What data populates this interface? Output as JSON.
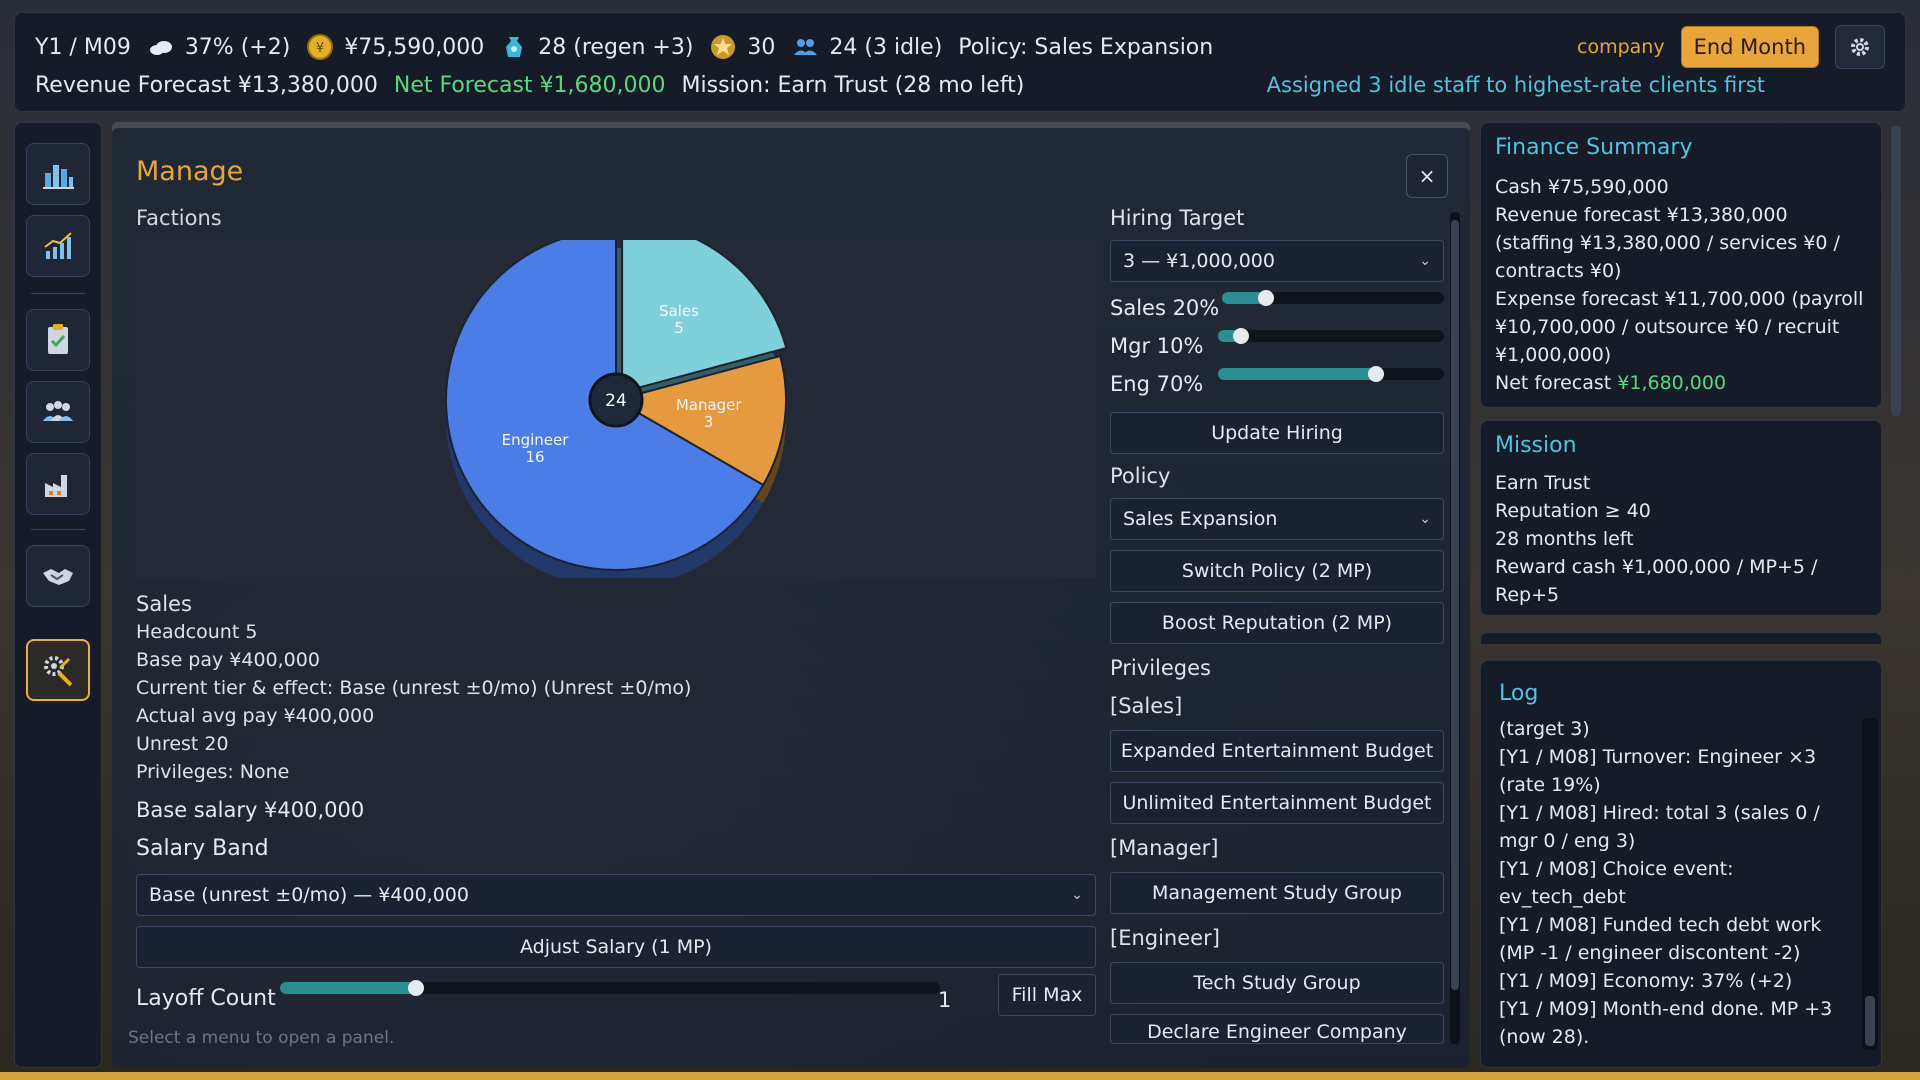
{
  "topbar": {
    "date": "Y1 / M09",
    "economy": "37% (+2)",
    "cash": "¥75,590,000",
    "mp": "28 (regen +3)",
    "reputation": "30",
    "staff": "24 (3 idle)",
    "policy": "Policy: Sales Expansion",
    "revenue_forecast": "Revenue Forecast ¥13,380,000",
    "net_forecast": "Net Forecast ¥1,680,000",
    "mission": "Mission: Earn Trust (28 mo left)",
    "company_label": "company",
    "end_month": "End Month",
    "assign_message": "Assigned 3 idle staff to highest-rate clients first"
  },
  "rail": {
    "items": [
      "analytics-icon",
      "growth-chart-icon",
      "clipboard-icon",
      "team-icon",
      "factory-icon",
      "handshake-icon",
      "settings-tools-icon"
    ],
    "active": "settings-tools-icon"
  },
  "manage": {
    "title": "Manage",
    "close": "×",
    "factions_label": "Factions",
    "chart_data": {
      "type": "pie",
      "categories": [
        "Sales",
        "Manager",
        "Engineer"
      ],
      "values": [
        5,
        3,
        16
      ],
      "total": "24",
      "colors": [
        "#7fd0da",
        "#e59a3f",
        "#4c7de6"
      ]
    },
    "sales_info": {
      "heading": "Sales",
      "headcount": "Headcount 5",
      "base_pay": "Base pay ¥400,000",
      "tier": "Current tier & effect: Base (unrest ±0/mo) (Unrest ±0/mo)",
      "avg_pay": "Actual avg pay ¥400,000",
      "unrest": "Unrest 20",
      "privileges": "Privileges: None"
    },
    "base_salary": "Base salary ¥400,000",
    "salary_band_label": "Salary Band",
    "salary_band_value": "Base (unrest ±0/mo) — ¥400,000",
    "adjust_salary": "Adjust Salary (1 MP)",
    "layoff_label": "Layoff Count",
    "layoff_value": "1",
    "layoff_fraction": 0.206,
    "fill_max": "Fill Max",
    "footer_hint": "Select a menu to open a panel.",
    "hiring_target_label": "Hiring Target",
    "hiring_target_value": "3 — ¥1,000,000",
    "sliders": [
      {
        "label": "Sales 20%",
        "value": 0.2
      },
      {
        "label": "Mgr 10%",
        "value": 0.1
      },
      {
        "label": "Eng 70%",
        "value": 0.7
      }
    ],
    "update_hiring": "Update Hiring",
    "policy_label": "Policy",
    "policy_value": "Sales Expansion",
    "switch_policy": "Switch Policy (2 MP)",
    "boost_reputation": "Boost Reputation (2 MP)",
    "privileges_label": "Privileges",
    "sales_group": "[Sales]",
    "expanded_budget": "Expanded Entertainment Budget",
    "unlimited_budget": "Unlimited Entertainment Budget",
    "manager_group": "[Manager]",
    "management_study": "Management Study Group",
    "engineer_group": "[Engineer]",
    "tech_study": "Tech Study Group",
    "declare_engineer": "Declare Engineer Company"
  },
  "finance": {
    "title": "Finance Summary",
    "cash": "Cash ¥75,590,000",
    "revenue_line1": "Revenue forecast ¥13,380,000",
    "revenue_line2": "(staffing ¥13,380,000 / services ¥0 /",
    "revenue_line3": "contracts ¥0)",
    "expense_line1": "Expense forecast ¥11,700,000 (payroll",
    "expense_line2": "¥10,700,000 / outsource ¥0 / recruit",
    "expense_line3": "¥1,000,000)",
    "net_label": "Net forecast",
    "net_value": "¥1,680,000"
  },
  "mission": {
    "title": "Mission",
    "name": "Earn Trust",
    "requirement": "Reputation ≥ 40",
    "time_left": "28 months left",
    "reward_line1": "Reward cash ¥1,000,000 / MP+5 /",
    "reward_line2": "Rep+5"
  },
  "log": {
    "title": "Log",
    "lines": [
      "(target 3)",
      "[Y1 / M08] Turnover: Engineer ×3",
      "(rate 19%)",
      "[Y1 / M08] Hired: total 3 (sales 0 /",
      "mgr 0 / eng 3)",
      "[Y1 / M08] Choice event:",
      "ev_tech_debt",
      "[Y1 / M08] Funded tech debt work",
      "(MP -1 / engineer discontent -2)",
      "[Y1 / M09] Economy: 37% (+2)",
      "[Y1 / M09] Month-end done. MP +3",
      "(now 28)."
    ]
  }
}
